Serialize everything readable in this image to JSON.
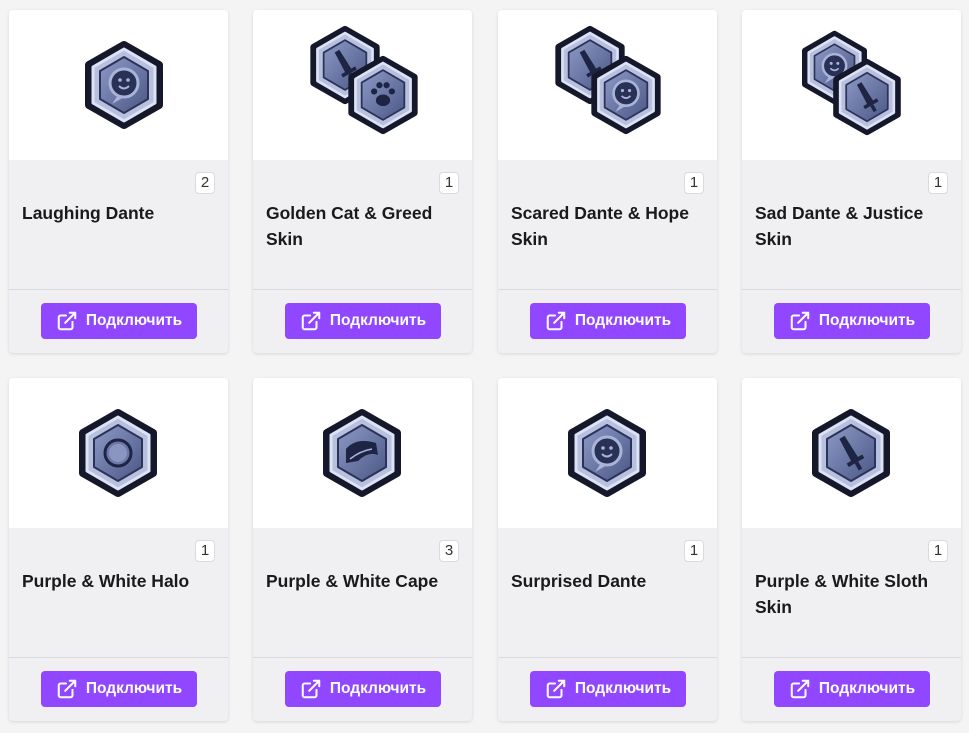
{
  "colors": {
    "accent": "#9146ff",
    "card_bg": "#f0f0f3",
    "page_bg": "#f4f4f5"
  },
  "button_icon": "external-link-icon",
  "items": [
    {
      "title": "Laughing Dante",
      "count": "2",
      "icon": "laughing-emote-badge-icon",
      "connect_label": "Подключить"
    },
    {
      "title": "Golden Cat & Greed Skin",
      "count": "1",
      "icon": "sword-and-paw-badges-icon",
      "connect_label": "Подключить"
    },
    {
      "title": "Scared Dante & Hope Skin",
      "count": "1",
      "icon": "sword-and-emote-badges-icon",
      "connect_label": "Подключить"
    },
    {
      "title": "Sad Dante & Justice Skin",
      "count": "1",
      "icon": "emote-and-sword-badges-icon",
      "connect_label": "Подключить"
    },
    {
      "title": "Purple & White Halo",
      "count": "1",
      "icon": "halo-badge-icon",
      "connect_label": "Подключить"
    },
    {
      "title": "Purple & White Cape",
      "count": "3",
      "icon": "cape-badge-icon",
      "connect_label": "Подключить"
    },
    {
      "title": "Surprised Dante",
      "count": "1",
      "icon": "surprised-emote-badge-icon",
      "connect_label": "Подключить"
    },
    {
      "title": "Purple & White Sloth Skin",
      "count": "1",
      "icon": "sword-badge-icon",
      "connect_label": "Подключить"
    }
  ]
}
